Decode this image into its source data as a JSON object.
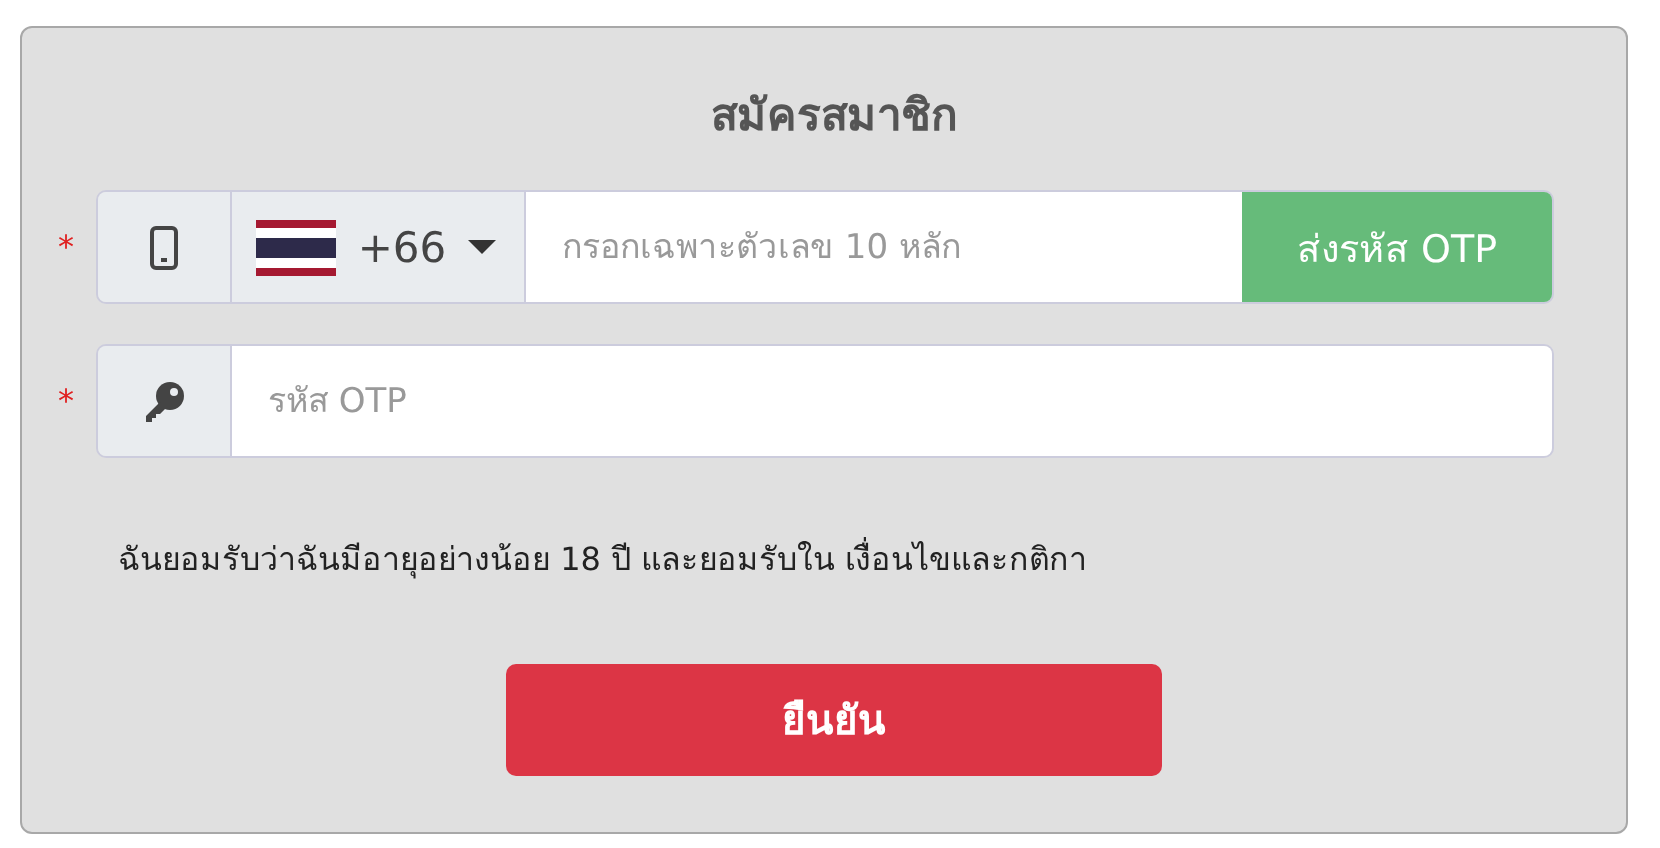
{
  "title": "สมัครสมาชิก",
  "phone_row": {
    "required_mark": "*",
    "country_code": "+66",
    "placeholder": "กรอกเฉพาะตัวเลข 10 หลัก",
    "send_button": "ส่งรหัส OTP"
  },
  "otp_row": {
    "required_mark": "*",
    "placeholder": "รหัส OTP"
  },
  "terms": "ฉันยอมรับว่าฉันมีอายุอย่างน้อย 18 ปี และยอมรับใน เงื่อนไขและกติกา",
  "confirm_button": "ยืนยัน"
}
